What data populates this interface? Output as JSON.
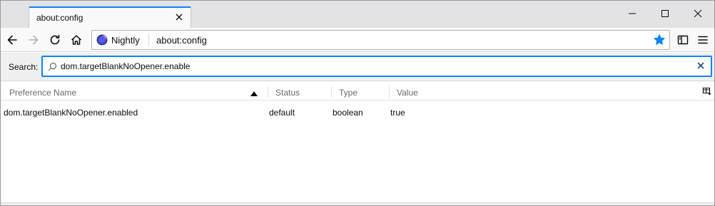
{
  "tab": {
    "title": "about:config"
  },
  "window": {
    "controls": [
      "minimize-icon",
      "maximize-icon",
      "close-icon"
    ]
  },
  "nav": {
    "identity_name": "Nightly",
    "url": "about:config"
  },
  "search": {
    "label": "Search:",
    "value": "dom.targetBlankNoOpener.enable"
  },
  "columns": {
    "name": "Preference Name",
    "status": "Status",
    "type": "Type",
    "value": "Value"
  },
  "rows": [
    {
      "name": "dom.targetBlankNoOpener.enabled",
      "status": "default",
      "type": "boolean",
      "value": "true"
    }
  ],
  "colors": {
    "accent": "#0a84ff",
    "tabstrip": "#e3e3e5"
  }
}
